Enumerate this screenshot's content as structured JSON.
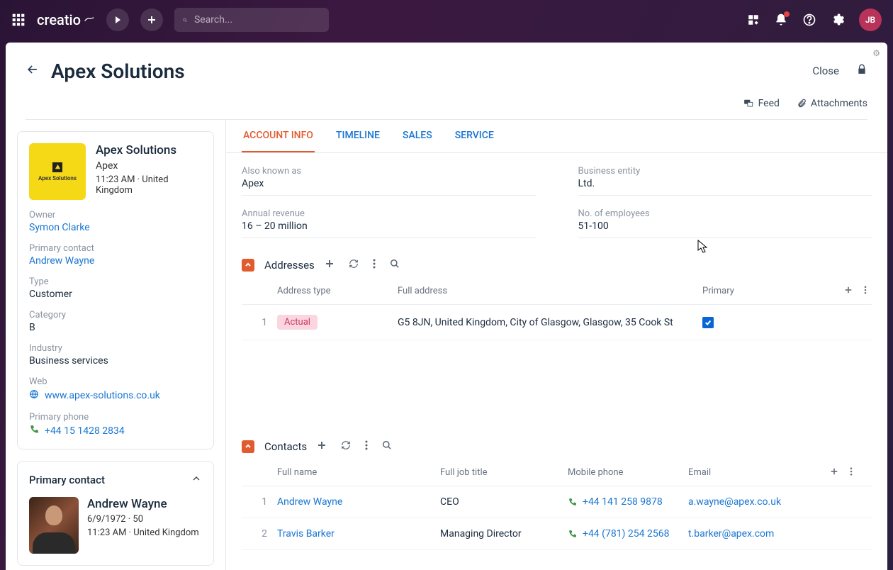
{
  "topbar": {
    "logo": "creatio",
    "search_placeholder": "Search...",
    "avatar": "JB"
  },
  "page": {
    "title": "Apex Solutions",
    "close_label": "Close",
    "feed_label": "Feed",
    "attachments_label": "Attachments"
  },
  "sidebar": {
    "account": {
      "name": "Apex Solutions",
      "short": "Apex",
      "logo_text": "Apex Solutions",
      "meta": "11:23 AM · United Kingdom"
    },
    "fields": {
      "owner_label": "Owner",
      "owner_value": "Symon Clarke",
      "primary_contact_label": "Primary contact",
      "primary_contact_value": "Andrew Wayne",
      "type_label": "Type",
      "type_value": "Customer",
      "category_label": "Category",
      "category_value": "B",
      "industry_label": "Industry",
      "industry_value": "Business services",
      "web_label": "Web",
      "web_value": "www.apex-solutions.co.uk",
      "phone_label": "Primary phone",
      "phone_value": "+44 15 1428 2834"
    },
    "primary_contact_card": {
      "title": "Primary contact",
      "name": "Andrew Wayne",
      "dob": "6/9/1972 · 50",
      "meta": "11:23 AM · United Kingdom"
    }
  },
  "tabs": {
    "account_info": "ACCOUNT INFO",
    "timeline": "TIMELINE",
    "sales": "SALES",
    "service": "SERVICE"
  },
  "info": {
    "aka_label": "Also known as",
    "aka_value": "Apex",
    "entity_label": "Business entity",
    "entity_value": "Ltd.",
    "revenue_label": "Annual revenue",
    "revenue_value": "16 – 20 million",
    "employees_label": "No. of employees",
    "employees_value": "51-100"
  },
  "addresses": {
    "title": "Addresses",
    "cols": {
      "type": "Address type",
      "full": "Full address",
      "primary": "Primary"
    },
    "rows": [
      {
        "num": "1",
        "type": "Actual",
        "full": "G5 8JN, United Kingdom, City of Glasgow, Glasgow, 35 Cook St",
        "primary": true
      }
    ]
  },
  "contacts": {
    "title": "Contacts",
    "cols": {
      "name": "Full name",
      "title": "Full job title",
      "mobile": "Mobile phone",
      "email": "Email"
    },
    "rows": [
      {
        "num": "1",
        "name": "Andrew Wayne",
        "title": "CEO",
        "mobile": "+44 141 258 9878",
        "email": "a.wayne@apex.co.uk"
      },
      {
        "num": "2",
        "name": "Travis Barker",
        "title": "Managing Director",
        "mobile": "+44 (781) 254 2568",
        "email": "t.barker@apex.com"
      }
    ]
  }
}
